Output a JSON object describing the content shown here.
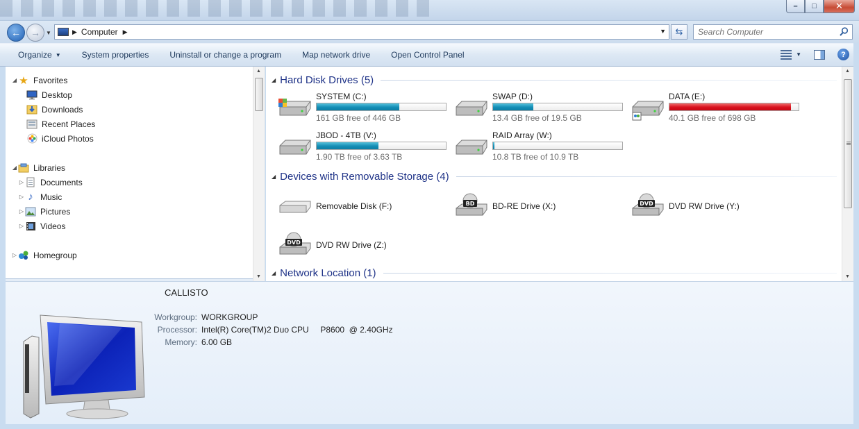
{
  "window": {
    "min_label": "–",
    "max_label": "□",
    "close_label": "✕"
  },
  "address": {
    "crumb": "Computer",
    "search_placeholder": "Search Computer"
  },
  "toolbar": {
    "organize": "Organize",
    "system_properties": "System properties",
    "uninstall": "Uninstall or change a program",
    "map_drive": "Map network drive",
    "control_panel": "Open Control Panel"
  },
  "nav": {
    "favorites": "Favorites",
    "desktop": "Desktop",
    "downloads": "Downloads",
    "recent": "Recent Places",
    "icloud": "iCloud Photos",
    "libraries": "Libraries",
    "documents": "Documents",
    "music": "Music",
    "pictures": "Pictures",
    "videos": "Videos",
    "homegroup": "Homegroup"
  },
  "groups": {
    "hdd": "Hard Disk Drives (5)",
    "removable": "Devices with Removable Storage (4)",
    "network": "Network Location (1)"
  },
  "drives": [
    {
      "name": "SYSTEM (C:)",
      "free": "161 GB free of 446 GB",
      "used_fraction": 0.64,
      "color": "#138db5"
    },
    {
      "name": "SWAP (D:)",
      "free": "13.4 GB free of 19.5 GB",
      "used_fraction": 0.31,
      "color": "#138db5"
    },
    {
      "name": "DATA (E:)",
      "free": "40.1 GB free of 698 GB",
      "used_fraction": 0.94,
      "color": "#d8101d"
    },
    {
      "name": "JBOD - 4TB (V:)",
      "free": "1.90 TB free of 3.63 TB",
      "used_fraction": 0.48,
      "color": "#138db5"
    },
    {
      "name": "RAID Array (W:)",
      "free": "10.8 TB free of 10.9 TB",
      "used_fraction": 0.01,
      "color": "#138db5"
    }
  ],
  "removable": [
    {
      "name": "Removable Disk (F:)",
      "badge": ""
    },
    {
      "name": "BD-RE Drive (X:)",
      "badge": "BD"
    },
    {
      "name": "DVD RW Drive (Y:)",
      "badge": "DVD"
    },
    {
      "name": "DVD RW Drive (Z:)",
      "badge": "DVD"
    }
  ],
  "details": {
    "computer_name": "CALLISTO",
    "workgroup_label": "Workgroup:",
    "workgroup": "WORKGROUP",
    "processor_label": "Processor:",
    "processor": "Intel(R) Core(TM)2 Duo CPU     P8600  @ 2.40GHz",
    "memory_label": "Memory:",
    "memory": "6.00 GB"
  }
}
